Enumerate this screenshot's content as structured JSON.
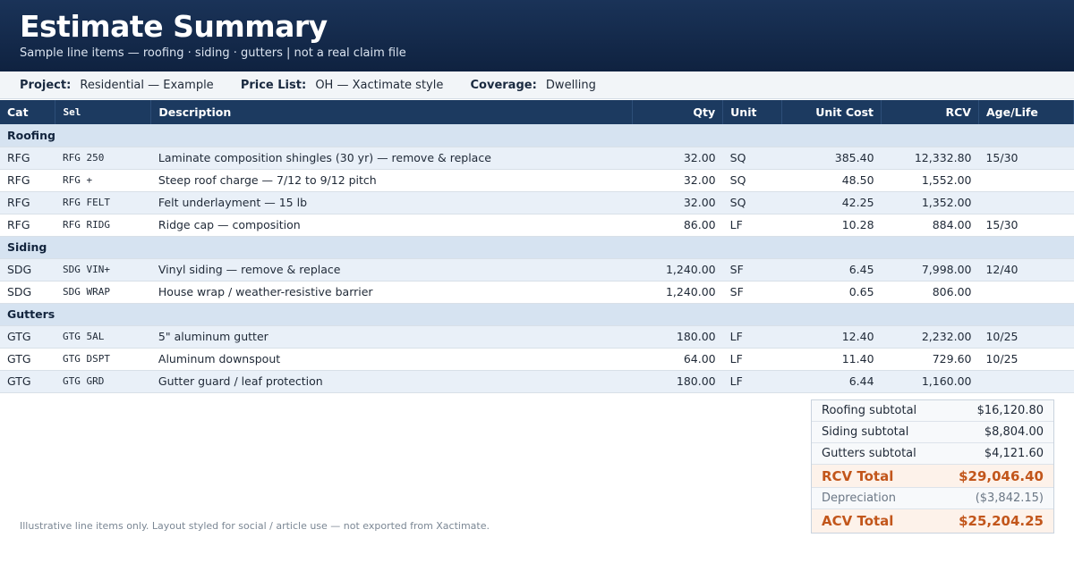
{
  "header": {
    "title": "Estimate Summary",
    "subtitle": "Sample line items — roofing · siding · gutters | not a real claim file"
  },
  "meta": {
    "project_label": "Project:",
    "project_value": "Residential — Example",
    "pricelist_label": "Price List:",
    "pricelist_value": "OH — Xactimate style",
    "coverage_label": "Coverage:",
    "coverage_value": "Dwelling"
  },
  "table": {
    "columns": [
      "Cat",
      "Sel",
      "Description",
      "Qty",
      "Unit",
      "Unit Cost",
      "RCV",
      "Age/Life"
    ],
    "sections": [
      {
        "name": "Roofing",
        "rows": [
          {
            "cat": "RFG",
            "sel": "RFG 250",
            "desc": "Laminate composition shingles (30 yr) — remove & replace",
            "qty": "32.00",
            "unit": "SQ",
            "unit_cost": "385.40",
            "rcv": "12,332.80",
            "age": "15/30"
          },
          {
            "cat": "RFG",
            "sel": "RFG +",
            "desc": "Steep roof charge — 7/12 to 9/12 pitch",
            "qty": "32.00",
            "unit": "SQ",
            "unit_cost": "48.50",
            "rcv": "1,552.00",
            "age": ""
          },
          {
            "cat": "RFG",
            "sel": "RFG FELT",
            "desc": "Felt underlayment — 15 lb",
            "qty": "32.00",
            "unit": "SQ",
            "unit_cost": "42.25",
            "rcv": "1,352.00",
            "age": ""
          },
          {
            "cat": "RFG",
            "sel": "RFG RIDG",
            "desc": "Ridge cap — composition",
            "qty": "86.00",
            "unit": "LF",
            "unit_cost": "10.28",
            "rcv": "884.00",
            "age": "15/30"
          }
        ]
      },
      {
        "name": "Siding",
        "rows": [
          {
            "cat": "SDG",
            "sel": "SDG VIN+",
            "desc": "Vinyl siding — remove & replace",
            "qty": "1,240.00",
            "unit": "SF",
            "unit_cost": "6.45",
            "rcv": "7,998.00",
            "age": "12/40"
          },
          {
            "cat": "SDG",
            "sel": "SDG WRAP",
            "desc": "House wrap / weather-resistive barrier",
            "qty": "1,240.00",
            "unit": "SF",
            "unit_cost": "0.65",
            "rcv": "806.00",
            "age": ""
          }
        ]
      },
      {
        "name": "Gutters",
        "rows": [
          {
            "cat": "GTG",
            "sel": "GTG 5AL",
            "desc": "5\" aluminum gutter",
            "qty": "180.00",
            "unit": "LF",
            "unit_cost": "12.40",
            "rcv": "2,232.00",
            "age": "10/25"
          },
          {
            "cat": "GTG",
            "sel": "GTG DSPT",
            "desc": "Aluminum downspout",
            "qty": "64.00",
            "unit": "LF",
            "unit_cost": "11.40",
            "rcv": "729.60",
            "age": "10/25"
          },
          {
            "cat": "GTG",
            "sel": "GTG GRD",
            "desc": "Gutter guard / leaf protection",
            "qty": "180.00",
            "unit": "LF",
            "unit_cost": "6.44",
            "rcv": "1,160.00",
            "age": ""
          }
        ]
      }
    ]
  },
  "totals": {
    "roofing_label": "Roofing subtotal",
    "roofing_value": "$16,120.80",
    "siding_label": "Siding subtotal",
    "siding_value": "$8,804.00",
    "gutters_label": "Gutters subtotal",
    "gutters_value": "$4,121.60",
    "rcv_label": "RCV Total",
    "rcv_value": "$29,046.40",
    "dep_label": "Depreciation",
    "dep_value": "($3,842.15)",
    "acv_label": "ACV Total",
    "acv_value": "$25,204.25"
  },
  "footnote": "Illustrative line items only. Layout styled for social / article use — not exported from Xactimate.",
  "colors": {
    "header_bg": "#12284a",
    "table_header_bg": "#1c3a60",
    "section_bg": "#d6e3f1",
    "row_alt_bg": "#e9f0f8",
    "accent_total": "#c2561b"
  }
}
